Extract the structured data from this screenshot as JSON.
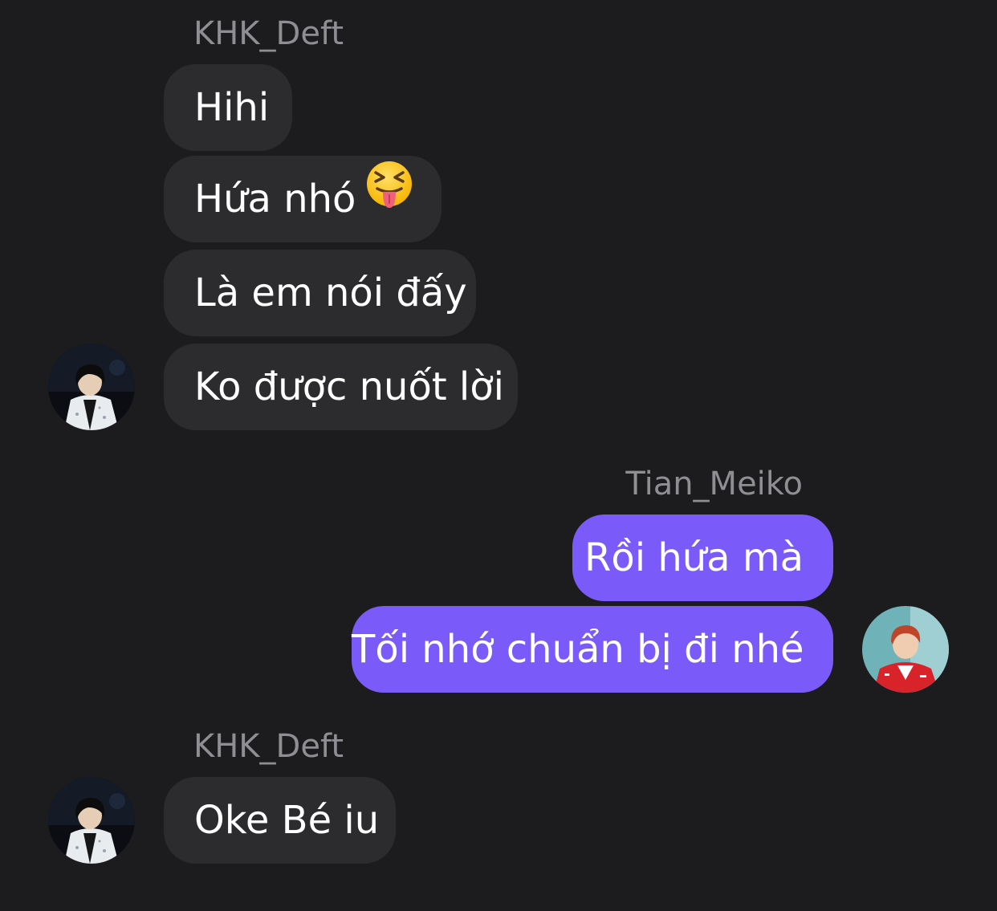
{
  "conversation": {
    "groups": [
      {
        "sender": "KHK_Deft",
        "side": "incoming",
        "messages": [
          "Hihi",
          "Hứa nhó",
          "Là em nói đấy",
          "Ko được nuốt lời"
        ],
        "message_emoji": {
          "1": "squinting-face-with-tongue-icon"
        }
      },
      {
        "sender": "Tian_Meiko",
        "side": "outgoing",
        "messages": [
          "Rồi hứa mà",
          "Tối nhớ chuẩn bị đi nhé"
        ]
      },
      {
        "sender": "KHK_Deft",
        "side": "incoming",
        "messages": [
          "Oke Bé iu"
        ]
      }
    ]
  },
  "colors": {
    "background": "#1c1c1e",
    "incoming_bubble": "#2c2c2e",
    "outgoing_bubble": "#7a5af8",
    "sender_name": "#8e8e93",
    "message_text": "#ffffff"
  },
  "icons": {
    "avatar_deft": "avatar-black-hair-white-jacket",
    "avatar_meiko": "avatar-red-hair-red-jacket"
  }
}
